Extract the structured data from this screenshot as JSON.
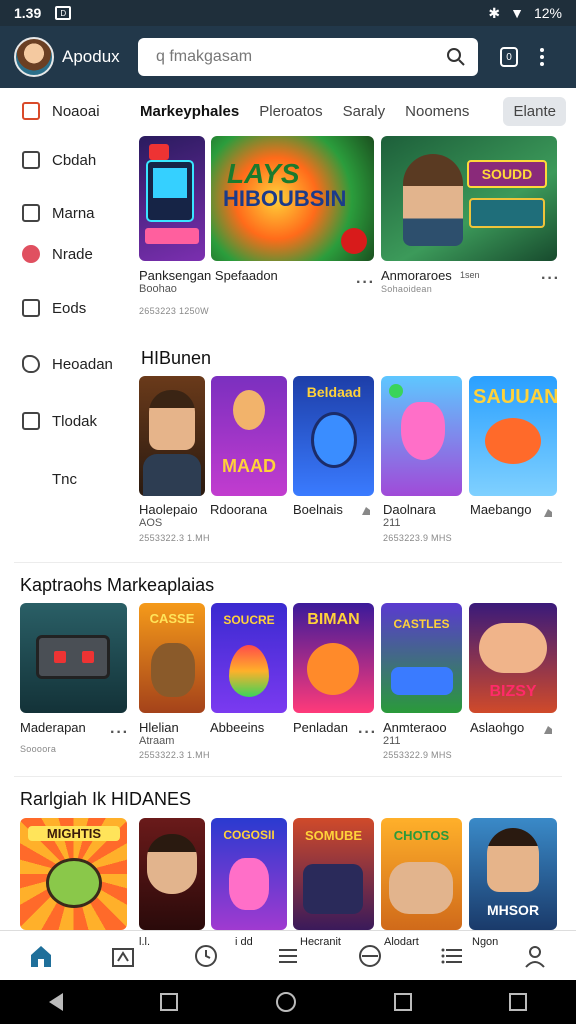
{
  "status": {
    "time": "1.39",
    "notif": "D",
    "battery": "12%"
  },
  "header": {
    "app_name": "Apodux",
    "search_placeholder": "q fmakgasam",
    "hex_label": "0"
  },
  "sidebar": {
    "items": [
      {
        "label": "Noaoai"
      },
      {
        "label": "Cbdah"
      },
      {
        "label": "Marna"
      },
      {
        "label": "Nrade"
      },
      {
        "label": "Eods"
      },
      {
        "label": "Heoadan"
      },
      {
        "label": "Tlodak"
      },
      {
        "label": "Tnc"
      }
    ]
  },
  "tabs": [
    "Markeyphales",
    "Pleroatos",
    "Saraly",
    "Noomens",
    "Elante"
  ],
  "featured": {
    "banner_text_1": "LAYS",
    "banner_text_2": "HIBOUBSIN",
    "banner3_text": "SOUDD",
    "row": [
      {
        "title": "Panksengan Spefaadon",
        "sub": "Boohao",
        "meta": "2653223 1250W"
      },
      {
        "title": "Anmoraroes",
        "sub": "Sohaoidean",
        "extra": "1sen"
      }
    ]
  },
  "section1": {
    "title": "HIBunen",
    "items": [
      {
        "title": "Haolepaio",
        "sub": "AOS",
        "meta": "2553322.3 1.MH",
        "art": "boy"
      },
      {
        "title": "Rdoorana",
        "art": "hero",
        "art_text": "MAAD"
      },
      {
        "title": "Boelnais",
        "art": "ninja",
        "art_text": "Beldaad"
      },
      {
        "title": "Daolnara",
        "sub": "211",
        "meta": "2653223.9 MHS",
        "art": "cat"
      },
      {
        "title": "Maebango",
        "art": "fish",
        "art_text": "SAUUAN"
      }
    ]
  },
  "section2": {
    "title": "Kaptraohs Markeaplaias",
    "items": [
      {
        "title": "Maderapan",
        "sub": "Soooora",
        "art": "robot"
      },
      {
        "title": "Hlelian",
        "sub": "Atraam",
        "meta": "2553322.3 1.MH",
        "art": "monster",
        "art_text": "CASSE"
      },
      {
        "title": "Abbeeins",
        "art": "drop",
        "art_text": "SOUCRE"
      },
      {
        "title": "Penladan",
        "art": "blob",
        "art_text": "BIMAN"
      },
      {
        "title": "Anmteraoo",
        "sub": "211",
        "meta": "2553322.9 MHS",
        "art": "car",
        "art_text": "CASTLES"
      },
      {
        "title": "Aslaohgo",
        "art": "team",
        "art_text": "BIZSY"
      }
    ]
  },
  "section3": {
    "title": "Rarlgiah Ik HIDANES",
    "items": [
      {
        "label": "",
        "art": "goblin",
        "art_text": "MIGHTIS"
      },
      {
        "label": "l.l.",
        "art": "guys"
      },
      {
        "label": "i dd",
        "art": "dino",
        "art_text": "COGOSII"
      },
      {
        "label": "Hecranit",
        "art": "ninjas",
        "art_text": "SOMUBE"
      },
      {
        "label": "Alodart",
        "art": "kids",
        "art_text": "CHOTOS"
      },
      {
        "label": "Ngon",
        "art": "man",
        "art_text": "MHSOR"
      }
    ]
  },
  "colors": {
    "appbar": "#22384a",
    "status": "#1f2f3b",
    "accent": "#1f6f9a"
  }
}
